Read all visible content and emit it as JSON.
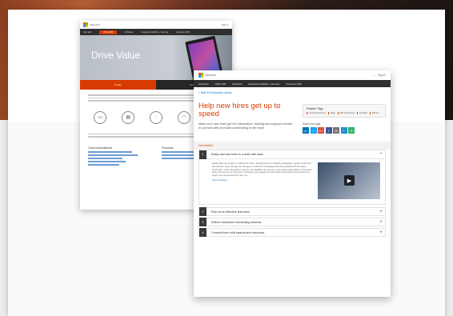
{
  "back_page": {
    "brand": "Microsoft",
    "header_right": "Sign in",
    "nav": [
      "Get Help",
      "Office 365",
      "Windows",
      "Enterprise Mobility + Security",
      "Dynamics 365"
    ],
    "hero_title": "Drive Value",
    "tabs": [
      "Create",
      "Network"
    ],
    "icon_labels": [
      "PC",
      "Doc",
      "Chat",
      "Call",
      "Mail"
    ],
    "col1_title": "Communications",
    "col2_title": "Process"
  },
  "front_page": {
    "brand": "Microsoft",
    "header_right": "Sign in",
    "nav": [
      "OneDrive",
      "Office 365",
      "Windows",
      "Enterprise Mobility + Security",
      "Dynamics 365"
    ],
    "back_link": "< Back to Productivity Library",
    "title": "Help new hires get up to speed",
    "description": "Make sure new hires get the information, training and support needed to connect with and start contributing to the team.",
    "related": {
      "heading": "Related Tags",
      "tags": [
        "Human Resources",
        "Sales",
        "Microsoft Teams",
        "OneNote",
        "Planner"
      ]
    },
    "share": {
      "heading": "Share this page",
      "icons": [
        "in",
        "t",
        "G+",
        "f",
        "✉",
        "≡",
        "⟳"
      ]
    },
    "get_started": "Get started",
    "steps": [
      {
        "num": "1",
        "label": "Easily add new hires to a team with ease",
        "toggle": "⌃"
      },
      {
        "num": "2",
        "label": "Plan for an effective first week",
        "toggle": "+"
      },
      {
        "num": "3",
        "label": "Deliver interactive onboarding sessions",
        "toggle": "+"
      },
      {
        "num": "4",
        "label": "Connect them with experts and resources",
        "toggle": "+"
      }
    ],
    "step1_text": "Easily add new people to a Microsoft Team, allowing them to instantly participate in group chats and discussions. They can tap into the team's collective knowledge and stay updated with the latest information. Chat, threaded in Teams, are available the minute a new person gets added to the Team. When the teams are structured, it will give your people the information and shared documents they need to be successful from day one.",
    "step1_link": "View Overlay >"
  },
  "colors": {
    "accent": "#d83b01",
    "nav_dark": "#2f2f2f",
    "link": "#0078d7"
  }
}
